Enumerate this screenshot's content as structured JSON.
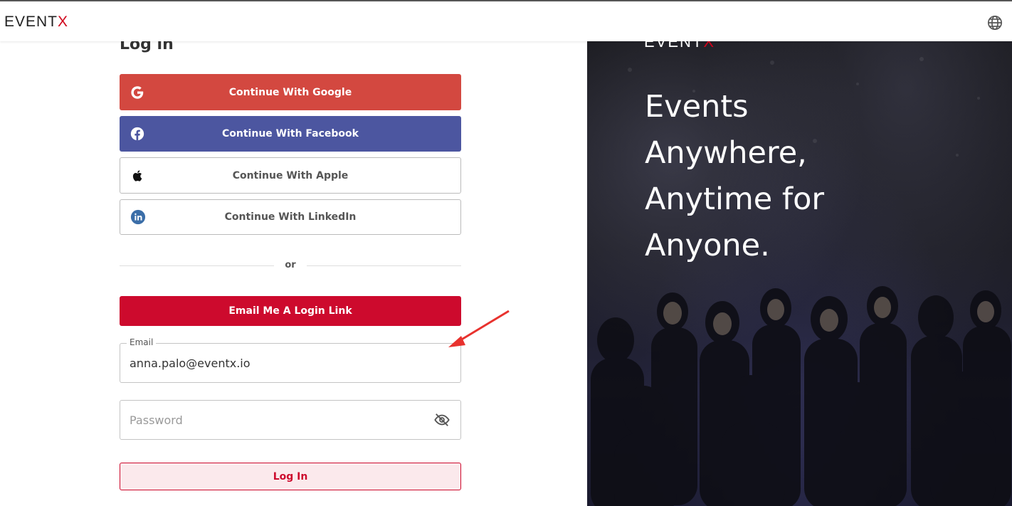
{
  "header": {
    "logo_text": "EVENT",
    "logo_accent": "X",
    "language_icon": "globe-icon"
  },
  "login": {
    "title": "Log in",
    "google_label": "Continue With Google",
    "facebook_label": "Continue With Facebook",
    "apple_label": "Continue With Apple",
    "linkedin_label": "Continue With LinkedIn",
    "divider_text": "or",
    "email_link_label": "Email Me A Login Link",
    "email_label": "Email",
    "email_value": "anna.palo@eventx.io",
    "password_placeholder": "Password",
    "login_button": "Log In"
  },
  "hero": {
    "logo_text": "EVENT",
    "logo_accent": "X",
    "headline_lines": [
      "Events",
      "Anywhere,",
      "Anytime for",
      "Anyone."
    ]
  },
  "colors": {
    "brand_red": "#cd0a2d",
    "google_red": "#d34840",
    "facebook_blue": "#4c56a0",
    "annotation_arrow": "#e8322e"
  }
}
